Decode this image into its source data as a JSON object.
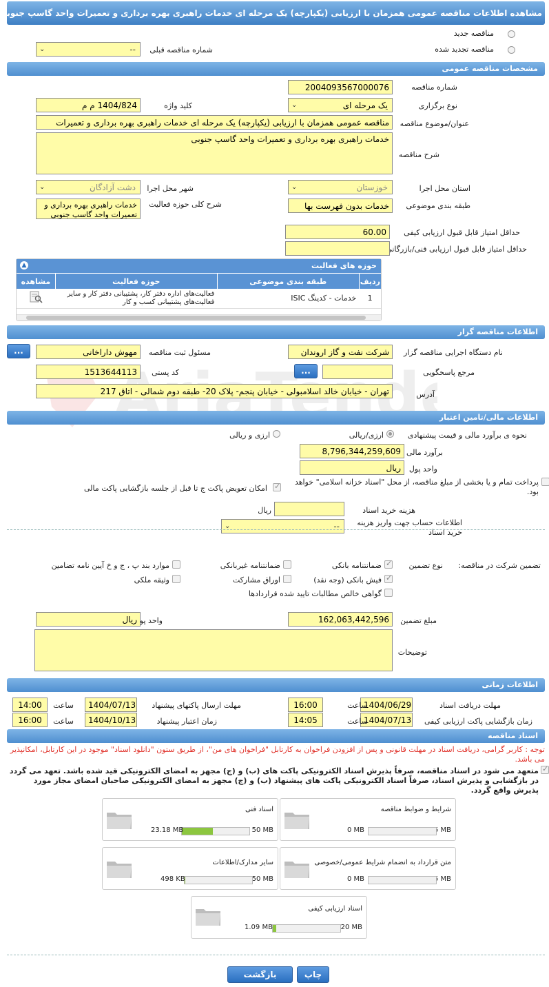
{
  "page_title": "مشاهده اطلاعات مناقصه عمومی همزمان با ارزیابی (یکپارچه) یک مرحله ای خدمات راهبری بهره برداری و تعمیرات واحد گاسپ جنوبی",
  "top": {
    "radio_new": "مناقصه جدید",
    "radio_renewed": "مناقصه تجدید شده",
    "prev_number_label": "شماره مناقصه قبلی",
    "prev_number_value": "--"
  },
  "general": {
    "header": "مشخصات مناقصه عمومی",
    "number_label": "شماره مناقصه",
    "number_value": "2004093567000076",
    "type_label": "نوع برگزاری",
    "type_value": "یک مرحله ای",
    "keyword_label": "کلید واژه",
    "keyword_value": "1404/824 م م",
    "subject_label": "عنوان/موضوع مناقصه",
    "subject_value": "مناقصه عمومی همزمان با ارزیابی (یکپارچه) یک مرحله ای خدمات راهبری بهره برداری و تعمیرات",
    "desc_label": "شرح مناقصه",
    "desc_value": "خدمات راهبری بهره برداری و تعمیرات واحد گاسپ جنوبی",
    "province_label": "استان محل اجرا",
    "province_value": "خوزستان",
    "city_label": "شهر محل اجرا",
    "city_value": "دشت آزادگان",
    "category_label": "طبقه بندی موضوعی",
    "category_value": "خدمات بدون فهرست بها",
    "scope_label": "شرح کلی حوزه فعالیت",
    "scope_value": "خدمات راهبری بهره برداری و تعمیرات واحد گاسپ جنوبی",
    "min_quality_label": "حداقل امتیاز قابل قبول ارزیابی کیفی",
    "min_quality_value": "60.00",
    "min_tech_label": "حداقل امتیاز قابل قبول ارزیابی فنی/بازرگانی",
    "min_tech_value": ""
  },
  "activities": {
    "header": "حوزه های فعالیت",
    "columns": [
      "ردیف",
      "طبقه بندی موضوعی",
      "حوزه فعالیت",
      "مشاهده"
    ],
    "rows": [
      {
        "idx": "1",
        "category": "خدمات - کدینگ ISIC",
        "field": "فعالیت‌های  اداره دفتر کار، پشتیبانی دفتر کار و سایر  فعالیت‌های پشتیبانی کسب و کار"
      }
    ]
  },
  "organizer": {
    "header": "اطلاعات مناقصه گزار",
    "org_label": "نام دستگاه اجرایی مناقصه گزار",
    "org_value": "شرکت نفت و گاز اروندان",
    "officer_label": "مسئول ثبت مناقصه",
    "officer_value": "مهوش داراخانی",
    "ref_label": "مرجع پاسخگویی",
    "ref_value": "",
    "postal_label": "کد پستی",
    "postal_value": "1513644113",
    "address_label": "آدرس",
    "address_value": "تهران - خیابان خالد اسلامبولی - خیابان پنجم- پلاک 20- طبقه دوم شمالی - اتاق 217",
    "more_btn": "..."
  },
  "finance": {
    "header": "اطلاعات مالی/تامین اعتبار",
    "estimate_method_label": "نحوه ی برآورد مالی و قیمت پیشنهادی",
    "opt_currency_rial": "ارزی/ریالی",
    "opt_currency_and_rial": "ارزی و ریالی",
    "estimate_label": "برآورد مالی",
    "estimate_value": "8,796,344,259,609",
    "unit_label": "واحد پول",
    "unit_value": "ریال",
    "treasury_text": "پرداخت تمام و یا بخشی از مبلغ مناقصه، از محل \"اسناد خزانه اسلامی\" خواهد بود.",
    "swap_text": "امکان تعویض پاکت ج تا قبل از جلسه بازگشایی پاکت مالی",
    "doc_cost_label": "هزینه خرید اسناد",
    "doc_cost_value": "",
    "doc_cost_unit": "ریال",
    "account_label": "اطلاعات حساب جهت واریز هزینه خرید اسناد",
    "account_value": "--"
  },
  "guarantee": {
    "section_label": "تضمین شرکت در مناقصه:",
    "type_label": "نوع تضمین",
    "bank_guarantee": "ضمانتنامه بانکی",
    "nonbank_guarantee": "ضمانتنامه غیربانکی",
    "clause_items": "موارد بند پ ، ج و خ آیین نامه تضامین",
    "bank_receipt": "فیش بانکی (وجه نقد)",
    "bonds": "اوراق مشارکت",
    "property": "وثیقه ملکی",
    "claims": "گواهی خالص مطالبات تایید شده قراردادها",
    "amount_label": "مبلغ تضمین",
    "amount_value": "162,063,442,596",
    "unit_label": "واحد پول",
    "unit_value": "ریال",
    "notes_label": "توضیحات",
    "notes_value": ""
  },
  "timing": {
    "header": "اطلاعات زمانی",
    "doc_deadline_label": "مهلت دریافت اسناد",
    "doc_deadline_date": "1404/06/29",
    "doc_deadline_time": "16:00",
    "send_deadline_label": "مهلت ارسال پاکتهای پیشنهاد",
    "send_deadline_date": "1404/07/13",
    "send_deadline_time": "14:00",
    "open_label": "زمان بازگشایی پاکت ارزیابی کیفی",
    "open_date": "1404/07/13",
    "open_time": "14:05",
    "validity_label": "زمان اعتبار پیشنهاد",
    "validity_date": "1404/10/13",
    "validity_time": "16:00",
    "time_word": "ساعت"
  },
  "documents": {
    "header": "اسناد مناقصه",
    "notice": "توجه : کاربر گرامی، دریافت اسناد در مهلت قانونی و پس از افزودن فراخوان به کارتابل \"فراخوان های من\"، از طریق ستون \"دانلود اسناد\" موجود در این کارتابل، امکانپذیر می باشد.",
    "commit": "متعهد می شود در اسناد مناقصه، صرفاً پذیرش اسناد الکترونیکی پاکت های (ب) و (ج) مجهز به امضای الکترونیکی قید شده باشد. تعهد می گردد در بازگشایی و پذیرش اسناد، صرفاً اسناد الکترونیکی پاکت های پیشنهاد (ب) و (ج) مجهز به امضای الکترونیکی صاحبان امضای مجاز مورد پذیرش واقع گردد.",
    "files": [
      {
        "name": "شرایط و ضوابط مناقصه",
        "max": "5 MB",
        "used": "0 MB",
        "fill": 0
      },
      {
        "name": "اسناد فنی",
        "max": "50 MB",
        "used": "23.18 MB",
        "fill": 0.46
      },
      {
        "name": "متن قرارداد به انضمام شرایط عمومی/خصوصی",
        "max": "5 MB",
        "used": "0 MB",
        "fill": 0
      },
      {
        "name": "سایر مدارک/اطلاعات",
        "max": "50 MB",
        "used": "498 KB",
        "fill": 0.01
      },
      {
        "name": "اسناد ارزیابی کیفی",
        "max": "20 MB",
        "used": "1.09 MB",
        "fill": 0.05
      }
    ]
  },
  "footer": {
    "print_btn": "چاپ",
    "back_btn": "بازگشت"
  }
}
